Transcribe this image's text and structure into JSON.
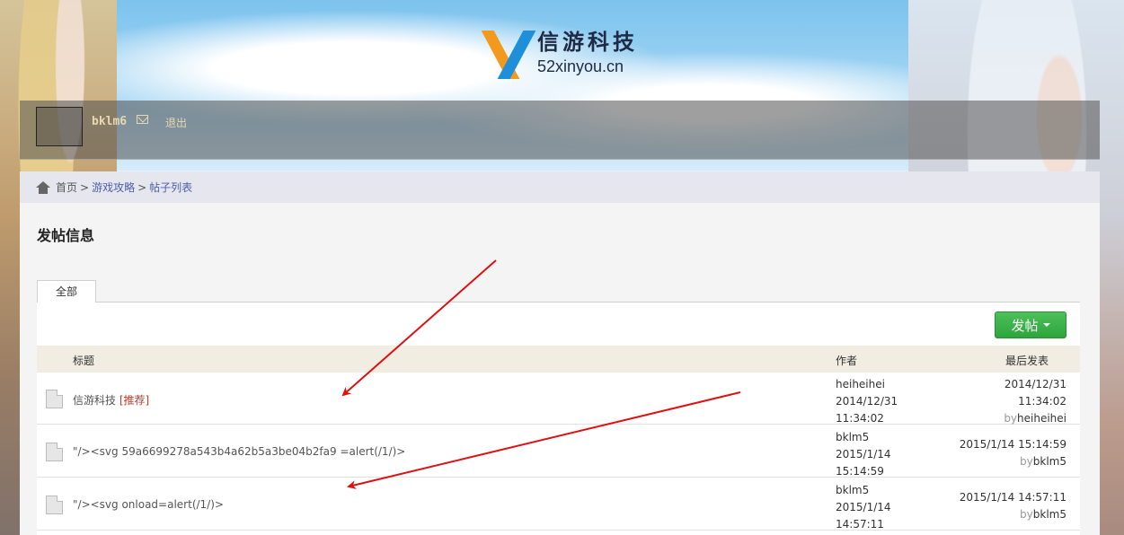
{
  "logo": {
    "cn": "信游科技",
    "en": "52xinyou.cn"
  },
  "userbar": {
    "username": "bklm6",
    "logout": "退出"
  },
  "breadcrumb": {
    "home": "首页",
    "sep1": ">",
    "section": "游戏攻略",
    "sep2": ">",
    "current": "帖子列表"
  },
  "section_title": "发帖信息",
  "tabs": [
    {
      "label": "全部"
    }
  ],
  "post_button": {
    "label": "发帖"
  },
  "table": {
    "headers": {
      "title": "标题",
      "author": "作者",
      "last": "最后发表"
    },
    "rows": [
      {
        "title": "信游科技",
        "tag": "[推荐]",
        "author_name": "heiheihei",
        "author_date": "2014/12/31",
        "author_time": "11:34:02",
        "last_date": "2014/12/31",
        "last_time": "11:34:02",
        "by": "by",
        "last_by": "heiheihei"
      },
      {
        "title": "\"/><svg 59a6699278a543b4a62b5a3be04b2fa9 =alert(/1/)>",
        "tag": "",
        "author_name": "bklm5",
        "author_date": "2015/1/14",
        "author_time": "15:14:59",
        "last_datetime": "2015/1/14 15:14:59",
        "by": "by",
        "last_by": "bklm5"
      },
      {
        "title": "\"/><svg onload=alert(/1/)>",
        "tag": "",
        "author_name": "bklm5",
        "author_date": "2015/1/14",
        "author_time": "14:57:11",
        "last_datetime": "2015/1/14 14:57:11",
        "by": "by",
        "last_by": "bklm5"
      }
    ]
  },
  "colors": {
    "post_button": "#2ea43c",
    "link": "#4d5fa8",
    "annotation_arrow": "#e01010",
    "recommend": "#c0392b"
  }
}
